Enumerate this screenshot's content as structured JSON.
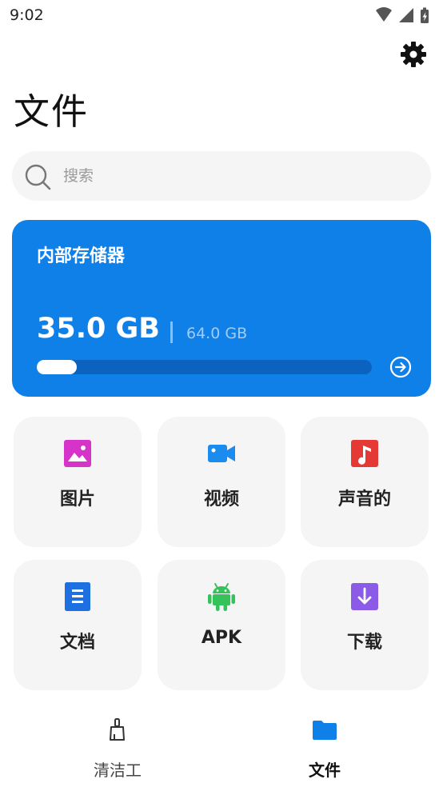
{
  "status_bar": {
    "time": "9:02"
  },
  "page": {
    "title": "文件"
  },
  "search": {
    "placeholder": "搜索",
    "value": ""
  },
  "storage": {
    "title": "内部存储器",
    "used": "35.0 GB",
    "total": "64.0 GB",
    "used_fraction": 0.12
  },
  "categories": [
    {
      "label": "图片",
      "icon": "image-icon",
      "color": "#d633c9"
    },
    {
      "label": "视频",
      "icon": "video-camera-icon",
      "color": "#1a8cf0"
    },
    {
      "label": "声音的",
      "icon": "music-note-icon",
      "color": "#e53935"
    },
    {
      "label": "文档",
      "icon": "document-icon",
      "color": "#1e6fe0"
    },
    {
      "label": "APK",
      "icon": "android-icon",
      "color": "#35c25a"
    },
    {
      "label": "下载",
      "icon": "download-icon",
      "color": "#8b5be8"
    }
  ],
  "nav": {
    "items": [
      {
        "label": "清洁工",
        "icon": "broom-icon",
        "active": false
      },
      {
        "label": "文件",
        "icon": "folder-icon",
        "active": true
      }
    ]
  },
  "colors": {
    "accent": "#1080e9",
    "nav_active_text": "#111111",
    "nav_inactive_text": "#444444"
  }
}
